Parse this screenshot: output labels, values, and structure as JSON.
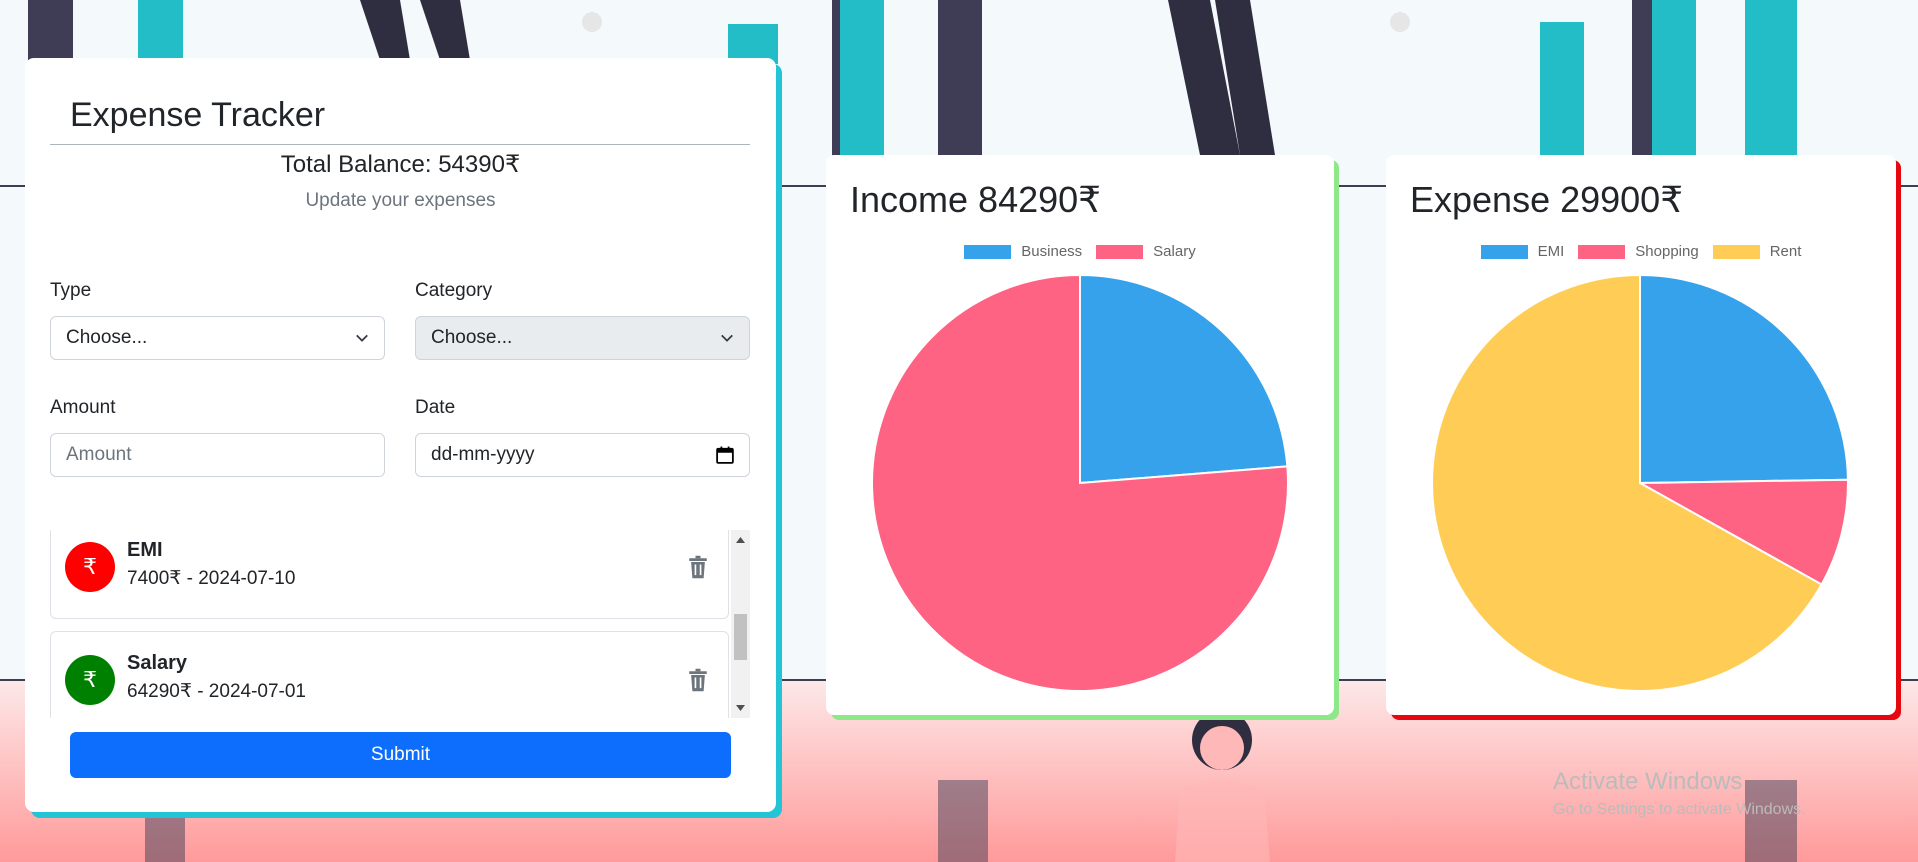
{
  "app": {
    "title": "Expense Tracker",
    "balance_text": "Total Balance: 54390₹",
    "subtitle": "Update your expenses"
  },
  "form": {
    "type_label": "Type",
    "type_value": "Choose...",
    "category_label": "Category",
    "category_value": "Choose...",
    "amount_label": "Amount",
    "amount_placeholder": "Amount",
    "date_label": "Date",
    "date_placeholder": "dd-mm-yyyy",
    "submit_label": "Submit"
  },
  "transactions": [
    {
      "name": "EMI",
      "detail": "7400₹ - 2024-07-10",
      "icon": "₹",
      "color": "#ff0000"
    },
    {
      "name": "Salary",
      "detail": "64290₹ - 2024-07-01",
      "icon": "₹",
      "color": "#008000"
    }
  ],
  "income_card": {
    "title": "Income 84290₹"
  },
  "expense_card": {
    "title": "Expense 29900₹"
  },
  "chart_data": [
    {
      "type": "pie",
      "title": "Income 84290₹",
      "categories": [
        "Business",
        "Salary"
      ],
      "values": [
        20000,
        64290
      ],
      "colors": [
        "#36a2eb",
        "#ff6384"
      ],
      "legend": "top"
    },
    {
      "type": "pie",
      "title": "Expense 29900₹",
      "categories": [
        "EMI",
        "Shopping",
        "Rent"
      ],
      "values": [
        7400,
        2500,
        20000
      ],
      "colors": [
        "#36a2eb",
        "#ff6384",
        "#ffcd56"
      ],
      "legend": "top"
    }
  ],
  "watermark": {
    "line1": "Activate Windows",
    "line2": "Go to Settings to activate Windows."
  },
  "colors": {
    "accent": "#22c4d6",
    "primary": "#0d6efd",
    "income_accent": "#8ee88a",
    "expense_accent": "#e8070f"
  }
}
